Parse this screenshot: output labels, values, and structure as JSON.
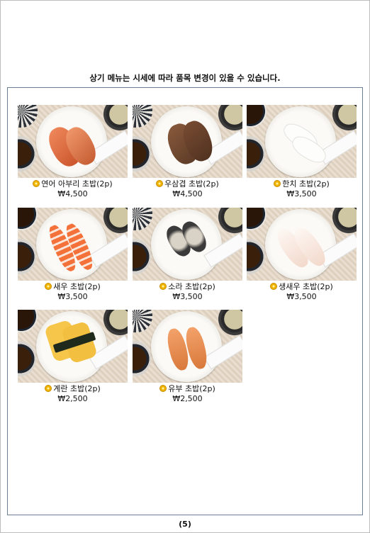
{
  "notice": "상기 메뉴는 시세에 따라 품목 변경이 있을 수 있습니다.",
  "items": [
    {
      "name": "연어 아부리 초밥(2p)",
      "price": "₩4,500",
      "icon": "sushi-photo"
    },
    {
      "name": "우삼겹 초밥(2p)",
      "price": "₩4,500",
      "icon": "sushi-photo"
    },
    {
      "name": "한치 초밥(2p)",
      "price": "₩3,500",
      "icon": "sushi-photo"
    },
    {
      "name": "새우 초밥(2p)",
      "price": "₩3,500",
      "icon": "sushi-photo"
    },
    {
      "name": "소라 초밥(2p)",
      "price": "₩3,500",
      "icon": "sushi-photo"
    },
    {
      "name": "생새우 초밥(2p)",
      "price": "₩3,500",
      "icon": "sushi-photo"
    },
    {
      "name": "계란 초밥(2p)",
      "price": "₩2,500",
      "icon": "sushi-photo"
    },
    {
      "name": "유부 초밥(2p)",
      "price": "₩2,500",
      "icon": "sushi-photo"
    }
  ],
  "page_number": "(5)"
}
